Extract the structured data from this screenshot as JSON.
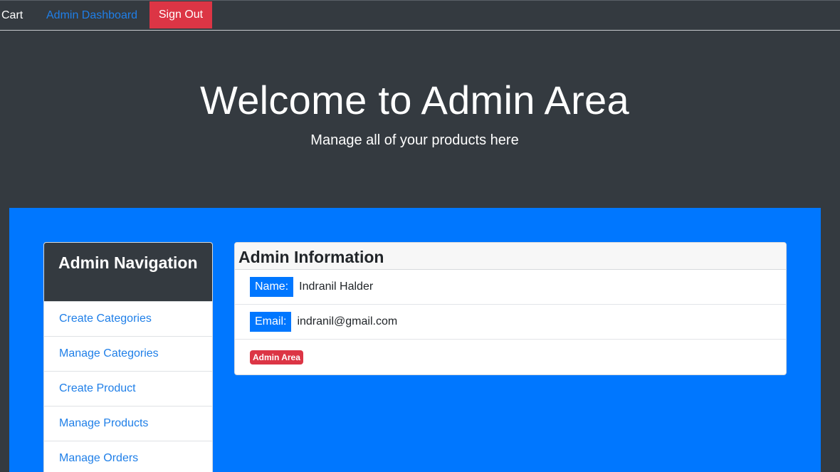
{
  "nav": {
    "cart": "Cart",
    "admin_dashboard": "Admin Dashboard",
    "sign_out": "Sign Out"
  },
  "hero": {
    "title": "Welcome to Admin Area",
    "subtitle": "Manage all of your products here"
  },
  "sidebar": {
    "title": "Admin Navigation",
    "items": [
      {
        "label": "Create Categories"
      },
      {
        "label": "Manage Categories"
      },
      {
        "label": "Create Product"
      },
      {
        "label": "Manage Products"
      },
      {
        "label": "Manage Orders"
      }
    ]
  },
  "info": {
    "title": "Admin Information",
    "name_label": "Name:",
    "name_value": "Indranil Halder",
    "email_label": "Email:",
    "email_value": "indranil@gmail.com",
    "badge": "Admin Area"
  },
  "colors": {
    "dark_bg": "#343a40",
    "primary": "#0077ff",
    "danger": "#dc3545",
    "link": "#1f7fe8"
  }
}
